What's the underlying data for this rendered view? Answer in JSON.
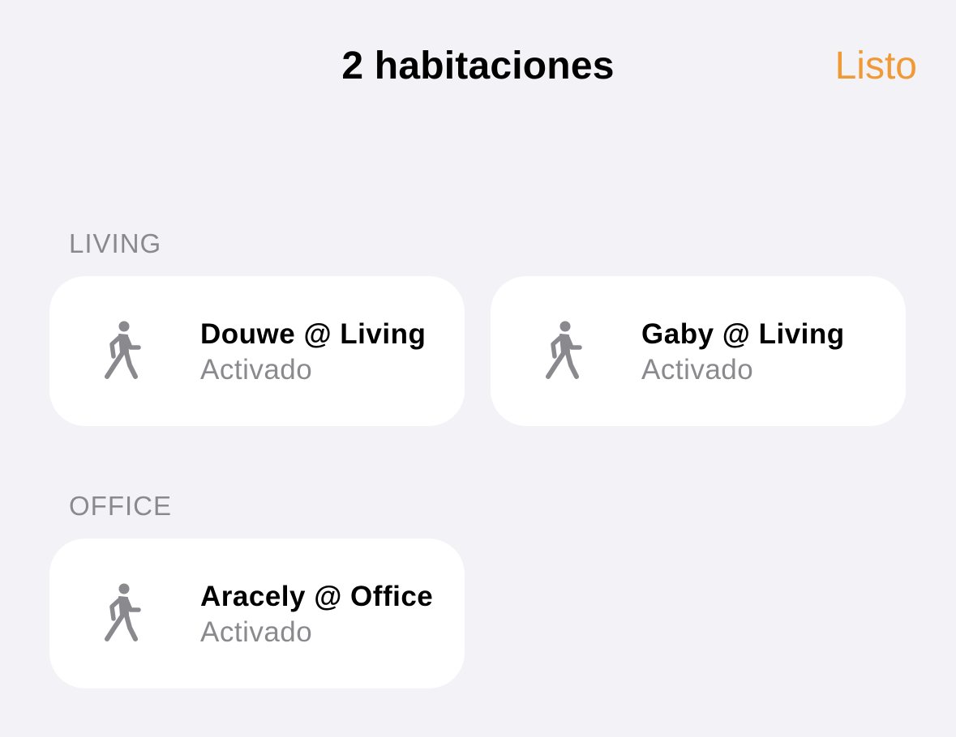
{
  "nav": {
    "title": "2 habitaciones",
    "done_label": "Listo"
  },
  "colors": {
    "accent": "#f09a37",
    "background": "#f2f2f7",
    "tile": "#ffffff",
    "secondary_text": "#8a8a8e",
    "icon": "#8a8a8e"
  },
  "sections": [
    {
      "header": "LIVING",
      "tiles": [
        {
          "icon": "walking-person-icon",
          "name": "Douwe @ Living",
          "status": "Activado"
        },
        {
          "icon": "walking-person-icon",
          "name": "Gaby @ Living",
          "status": "Activado"
        }
      ]
    },
    {
      "header": "OFFICE",
      "tiles": [
        {
          "icon": "walking-person-icon",
          "name": "Aracely @ Office",
          "status": "Activado"
        }
      ]
    }
  ]
}
